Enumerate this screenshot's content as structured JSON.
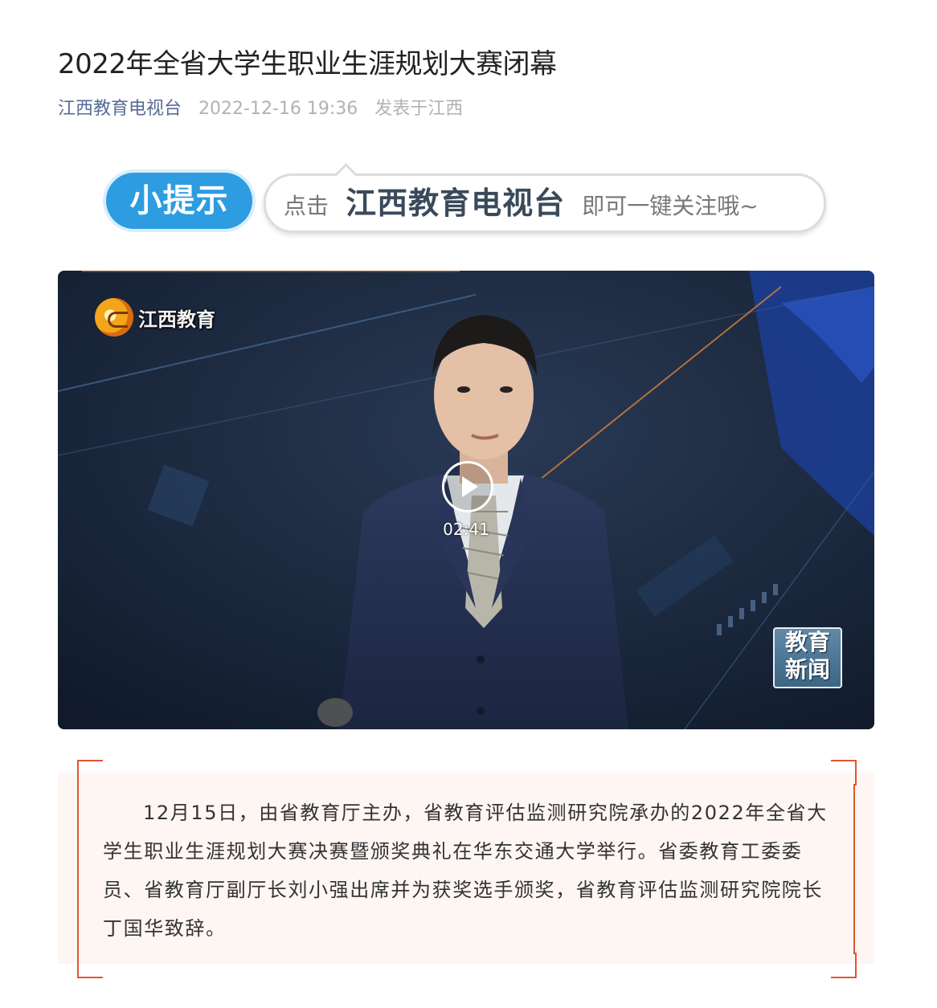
{
  "article": {
    "title": "2022年全省大学生职业生涯规划大赛闭幕",
    "account": "江西教育电视台",
    "datetime": "2022-12-16 19:36",
    "location": "发表于江西"
  },
  "tip_banner": {
    "badge": "小提示",
    "prefix": "点击",
    "account": "江西教育电视台",
    "suffix": "即可一键关注哦~"
  },
  "video": {
    "channel_logo_text": "江西教育",
    "badge_line1": "教育",
    "badge_line2": "新闻",
    "duration": "02:41",
    "play_icon": "play-icon"
  },
  "body": {
    "paragraph": "12月15日，由省教育厅主办，省教育评估监测研究院承办的2022年全省大学生职业生涯规划大赛决赛暨颁奖典礼在华东交通大学举行。省委教育工委委员、省教育厅副厅长刘小强出席并为获奖选手颁奖，省教育评估监测研究院院长丁国华致辞。"
  },
  "colors": {
    "account_link": "#576b95",
    "meta_gray": "#b2b2b2",
    "accent_red": "#e0562f",
    "tip_blue": "#2d9ce0",
    "quote_bg": "#fdf6f3"
  }
}
